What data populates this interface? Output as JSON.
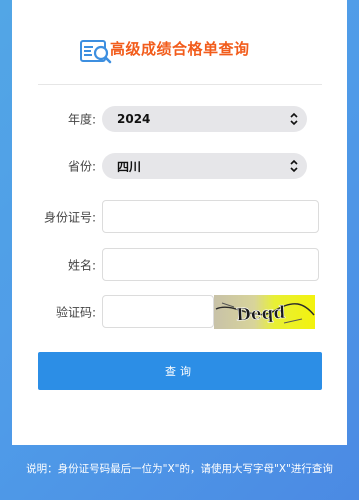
{
  "header": {
    "title": "高级成绩合格单查询"
  },
  "form": {
    "year": {
      "label": "年度:",
      "value": "2024"
    },
    "province": {
      "label": "省份:",
      "value": "四川"
    },
    "id_number": {
      "label": "身份证号:",
      "value": "",
      "placeholder": ""
    },
    "name": {
      "label": "姓名:",
      "value": "",
      "placeholder": ""
    },
    "captcha": {
      "label": "验证码:",
      "value": "",
      "placeholder": "",
      "image_text": "Deqd"
    },
    "submit_label": "查询"
  },
  "footer": {
    "note": "说明：身份证号码最后一位为\"X\"的，请使用大写字母\"X\"进行查询"
  },
  "colors": {
    "title": "#f25c1b",
    "button": "#2c8ee6",
    "background": "#4f9be8"
  }
}
